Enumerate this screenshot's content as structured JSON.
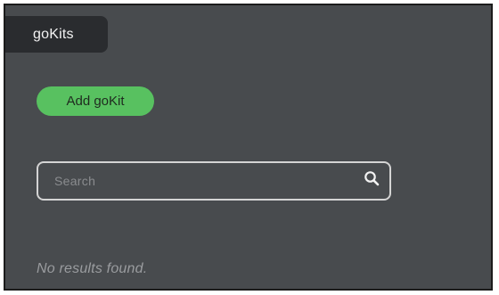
{
  "header": {
    "tab_label": "goKits"
  },
  "actions": {
    "add_label": "Add goKit"
  },
  "search": {
    "placeholder": "Search",
    "value": "",
    "icon": "search-icon"
  },
  "results": {
    "empty_message": "No results found."
  },
  "colors": {
    "background": "#484b4e",
    "tab": "#2a2c2f",
    "accent": "#58c160",
    "border": "#d4d4d4"
  }
}
